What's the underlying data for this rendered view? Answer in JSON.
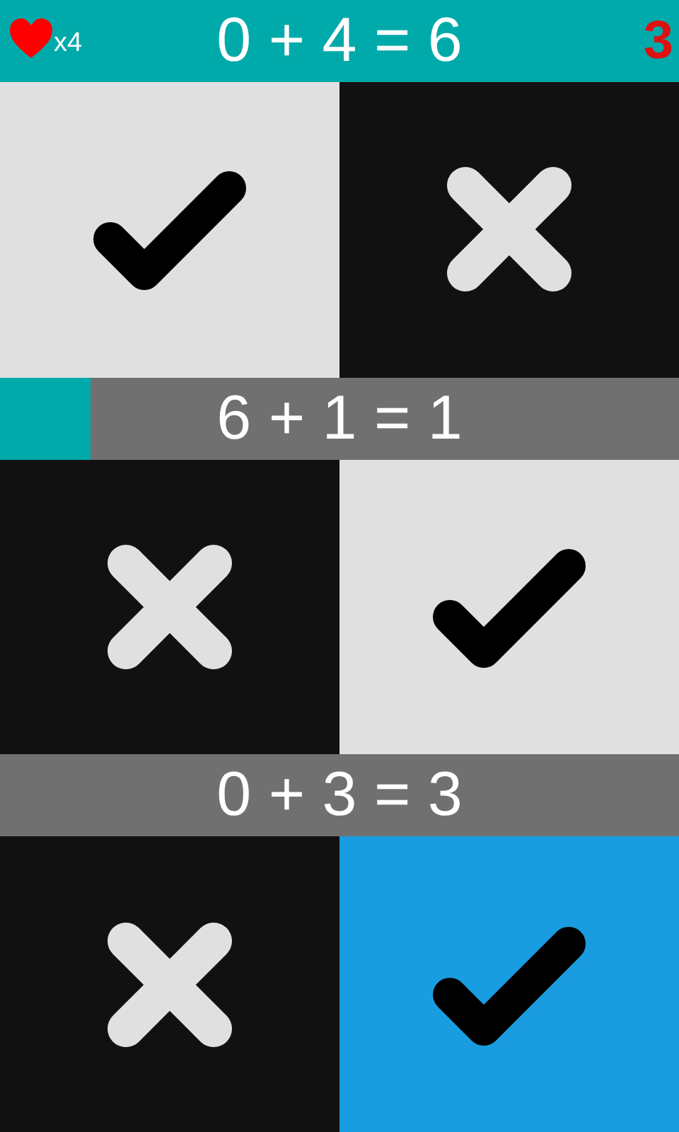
{
  "status": {
    "lives": "x4",
    "score": "3"
  },
  "questions": [
    {
      "equation": "0 + 4 = 6",
      "level": 1,
      "choices": [
        {
          "kind": "check",
          "selected": false
        },
        {
          "kind": "cross",
          "selected": false
        }
      ]
    },
    {
      "equation": "6 + 1 = 1",
      "level": 0.133,
      "choices": [
        {
          "kind": "cross",
          "selected": false
        },
        {
          "kind": "check",
          "selected": false
        }
      ]
    },
    {
      "equation": "0 + 3 = 3",
      "level": 0,
      "choices": [
        {
          "kind": "cross",
          "selected": false
        },
        {
          "kind": "check",
          "selected": true
        }
      ]
    }
  ]
}
